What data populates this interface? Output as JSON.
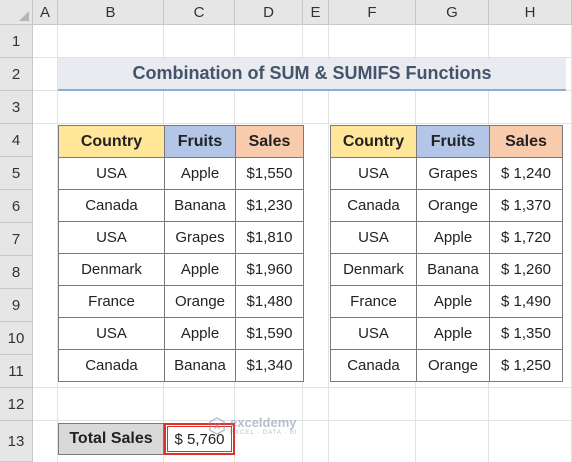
{
  "columns": [
    "A",
    "B",
    "C",
    "D",
    "E",
    "F",
    "G",
    "H"
  ],
  "rows": [
    "1",
    "2",
    "3",
    "4",
    "5",
    "6",
    "7",
    "8",
    "9",
    "10",
    "11",
    "12",
    "13"
  ],
  "title": "Combination of SUM & SUMIFS Functions",
  "table1": {
    "headers": [
      "Country",
      "Fruits",
      "Sales"
    ],
    "rows": [
      [
        "USA",
        "Apple",
        "$1,550"
      ],
      [
        "Canada",
        "Banana",
        "$1,230"
      ],
      [
        "USA",
        "Grapes",
        "$1,810"
      ],
      [
        "Denmark",
        "Apple",
        "$1,960"
      ],
      [
        "France",
        "Orange",
        "$1,480"
      ],
      [
        "USA",
        "Apple",
        "$1,590"
      ],
      [
        "Canada",
        "Banana",
        "$1,340"
      ]
    ]
  },
  "table2": {
    "headers": [
      "Country",
      "Fruits",
      "Sales"
    ],
    "rows": [
      [
        "USA",
        "Grapes",
        "$ 1,240"
      ],
      [
        "Canada",
        "Orange",
        "$ 1,370"
      ],
      [
        "USA",
        "Apple",
        "$ 1,720"
      ],
      [
        "Denmark",
        "Banana",
        "$ 1,260"
      ],
      [
        "France",
        "Apple",
        "$ 1,490"
      ],
      [
        "USA",
        "Apple",
        "$ 1,350"
      ],
      [
        "Canada",
        "Orange",
        "$ 1,250"
      ]
    ]
  },
  "total": {
    "label": "Total Sales",
    "value": "$ 5,760"
  },
  "watermark": {
    "name": "exceldemy",
    "tagline": "EXCEL · DATA · BI"
  },
  "colors": {
    "country_header": "#ffe699",
    "fruits_header": "#b4c6e7",
    "sales_header": "#f8cbad",
    "highlight": "#e0302a"
  }
}
